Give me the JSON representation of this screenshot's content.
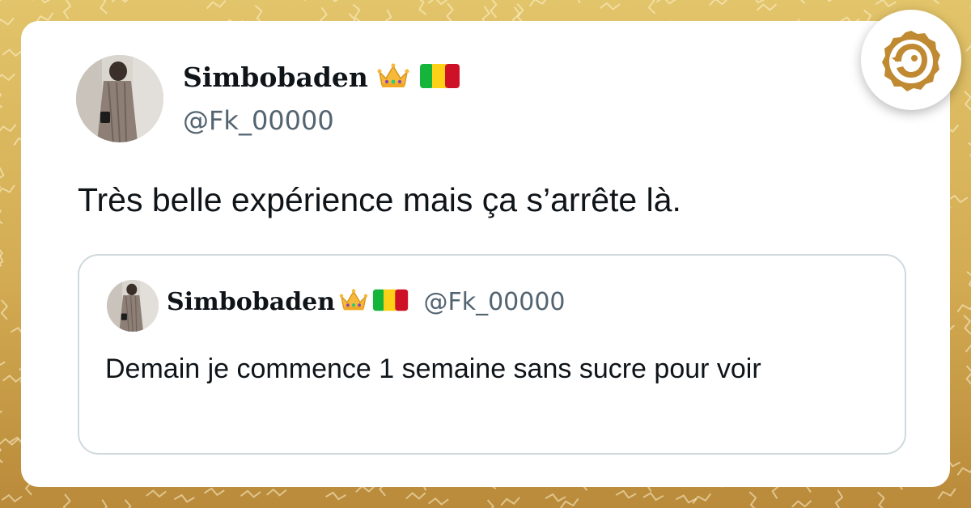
{
  "colors": {
    "background_gold": "#d3ab52",
    "card": "#ffffff",
    "text_primary": "#0f1419",
    "text_secondary": "#536471",
    "quote_border": "#cfd9de",
    "logo_gold": "#c08a32"
  },
  "tweet": {
    "display_name": "Simbobaden",
    "name_emojis": [
      "crown-emoji",
      "mali-flag-emoji"
    ],
    "handle": "@Fk_00000",
    "text": "Très belle expérience mais ça s’arrête là."
  },
  "quoted_tweet": {
    "display_name": "Simbobaden",
    "name_emojis": [
      "crown-emoji",
      "mali-flag-emoji"
    ],
    "handle": "@Fk_00000",
    "text": "Demain je commence 1 semaine sans sucre pour voir"
  },
  "brand_logo": {
    "icon": "bird-logo-icon"
  }
}
